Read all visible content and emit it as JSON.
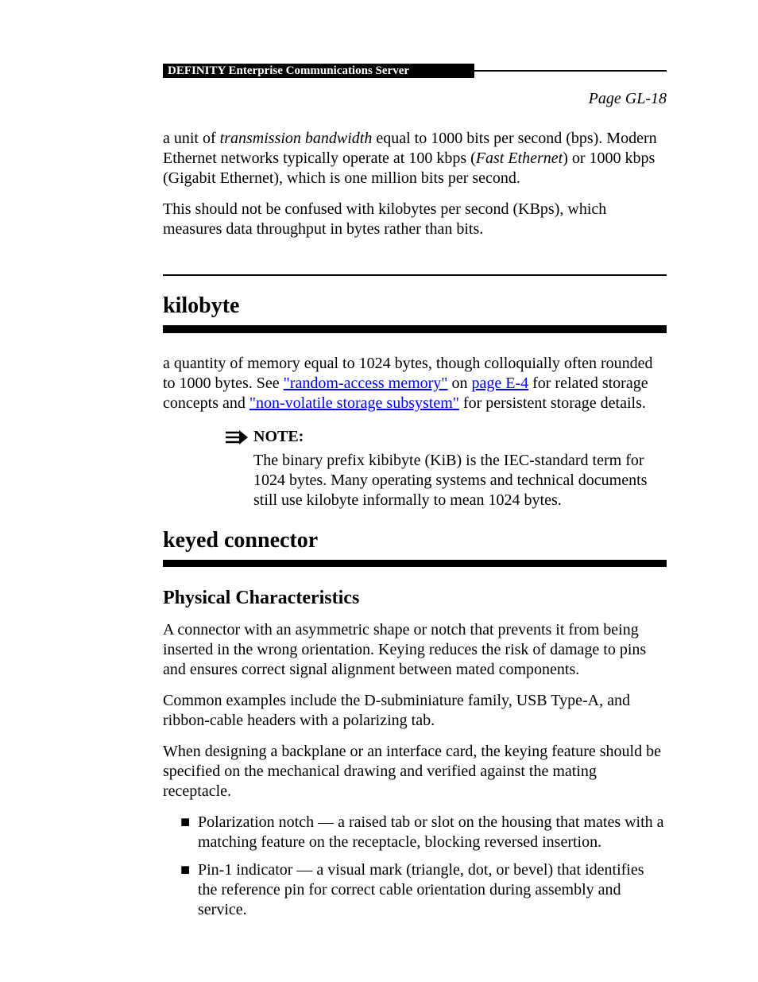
{
  "header": {
    "black_bar": "DEFINITY Enterprise Communications Server",
    "page_label": "Page GL-18"
  },
  "intro": {
    "p1_prefix": "a unit of ",
    "italic1": "transmission bandwidth",
    "p1_mid": " equal to 1000 bits per second (bps). Modern Ethernet networks typically operate at 100 kbps (",
    "italic2": "Fast Ethernet",
    "p1_suffix": ") or 1000 kbps (Gigabit Ethernet), which is one million bits per second.",
    "p2": "This should not be confused with kilobytes per second (KBps), which measures data throughput in bytes rather than bits."
  },
  "section": {
    "title": "kilobyte",
    "p_before_link1": "a quantity of memory equal to 1024 bytes, though colloquially often rounded to 1000 bytes. See ",
    "link1": "\"random-access memory\"",
    "p_between": " on ",
    "link2": "page E-4",
    "p_after_link2": " for related storage concepts and ",
    "link3": "\"non-volatile storage subsystem\"",
    "p_trailing": " for persistent storage details."
  },
  "note": {
    "label": "NOTE:",
    "body": "The binary prefix kibibyte (KiB) is the IEC-standard term for 1024 bytes. Many operating systems and technical documents still use kilobyte informally to mean 1024 bytes."
  },
  "section2": {
    "title": "keyed connector",
    "subheading": "Physical Characteristics",
    "p1": "A connector with an asymmetric shape or notch that prevents it from being inserted in the wrong orientation. Keying reduces the risk of damage to pins and ensures correct signal alignment between mated components.",
    "p2": "Common examples include the D-subminiature family, USB Type-A, and ribbon-cable headers with a polarizing tab.",
    "p3": "When designing a backplane or an interface card, the keying feature should be specified on the mechanical drawing and verified against the mating receptacle.",
    "bullets": [
      "Polarization notch — a raised tab or slot on the housing that mates with a matching feature on the receptacle, blocking reversed insertion.",
      "Pin-1 indicator — a visual mark (triangle, dot, or bevel) that identifies the reference pin for correct cable orientation during assembly and service."
    ]
  }
}
